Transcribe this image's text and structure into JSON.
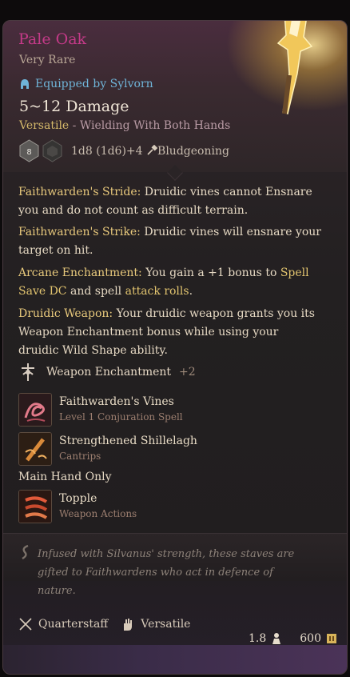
{
  "item": {
    "name": "Pale Oak",
    "rarity": "Very Rare",
    "equipped": "Equipped by Sylvorn",
    "damage": "5~12 Damage",
    "versatile": "Versatile",
    "versatile_note": " - Wielding With Both Hands",
    "dice_text": "1d8 (1d6)+4",
    "damage_type": "Bludgeoning",
    "die_label": "8"
  },
  "properties": [
    {
      "key": "Faithwarden's Stride:",
      "text": " Druidic vines cannot Ensnare you and do not count as difficult terrain."
    },
    {
      "key": "Faithwarden's Strike:",
      "text": " Druidic vines will ensnare your target on hit."
    },
    {
      "key": "Arcane Enchantment:",
      "text_a": " You gain a +1 bonus to ",
      "hl_a": "Spell Save DC",
      "text_b": " and spell ",
      "hl_b": "attack rolls",
      "text_c": "."
    },
    {
      "key": "Druidic Weapon:",
      "text": " Your druidic weapon grants you its Weapon Enchantment bonus while using your druidic Wild Shape ability."
    }
  ],
  "enchantment": {
    "label": "Weapon Enchantment",
    "bonus": "+2"
  },
  "spells": [
    {
      "name": "Faithwarden's Vines",
      "sub": "Level 1 Conjuration Spell"
    },
    {
      "name": "Strengthened Shillelagh",
      "sub": "Cantrips"
    }
  ],
  "main_hand_label": "Main Hand Only",
  "actions": [
    {
      "name": "Topple",
      "sub": "Weapon Actions"
    }
  ],
  "flavor": "Infused with Silvanus' strength, these staves are gifted to Faithwardens who act in defence of nature.",
  "traits": {
    "weapon_type": "Quarterstaff",
    "property": "Versatile"
  },
  "stats": {
    "weight": "1.8",
    "value": "600"
  },
  "colors": {
    "title": "#c43a88",
    "equipped": "#6fb4d8",
    "keyword": "#e8c97c",
    "rarity": "#b8a695"
  },
  "icons": [
    "helmet-icon",
    "die-icon",
    "hammer-icon",
    "enchantment-icon",
    "vines-icon",
    "shillelagh-icon",
    "topple-icon",
    "flavor-icon",
    "quarterstaff-icon",
    "versatile-icon",
    "weight-icon",
    "gold-icon"
  ]
}
